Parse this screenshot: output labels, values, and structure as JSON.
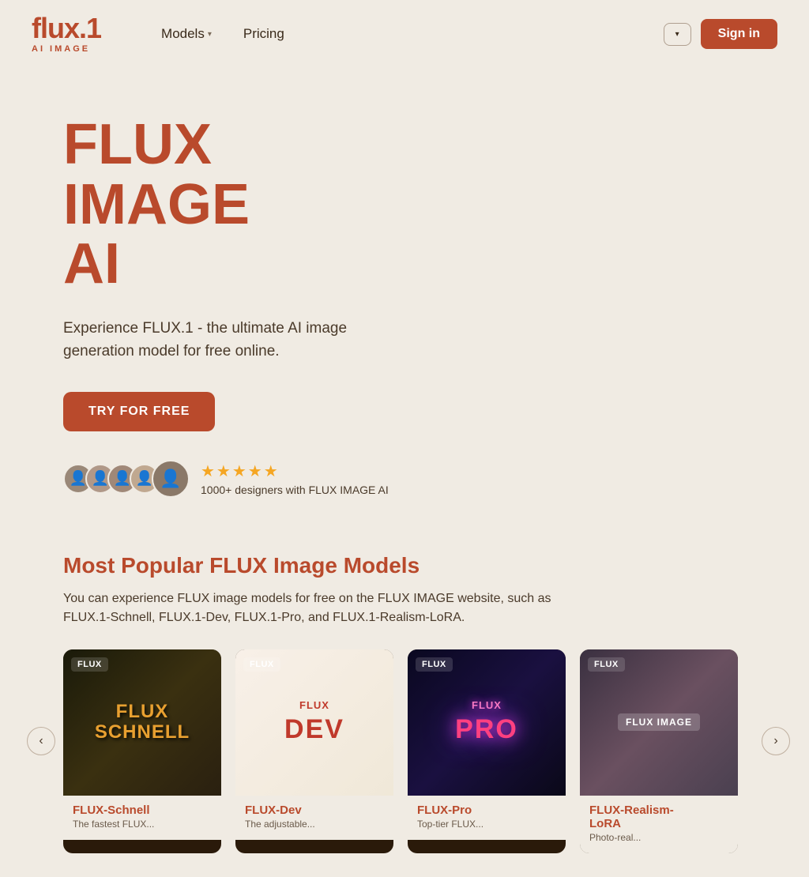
{
  "nav": {
    "logo": {
      "main": "flux.1",
      "sub": "AI IMAGE"
    },
    "models_label": "Models",
    "pricing_label": "Pricing",
    "lang_button": "▾",
    "signin_label": "Sign in"
  },
  "hero": {
    "title_line1": "FLUX IMAGE",
    "title_line2": "AI",
    "description": "Experience FLUX.1 - the ultimate AI image generation model for free online.",
    "cta_label": "TRY FOR FREE"
  },
  "social_proof": {
    "stars": "★★★★★",
    "text": "1000+ designers with FLUX IMAGE AI"
  },
  "models_section": {
    "heading": "Most Popular FLUX Image Models",
    "description": "You can experience FLUX image models for free on the FLUX IMAGE website, such as FLUX.1-Schnell, FLUX.1-Dev, FLUX.1-Pro, and FLUX.1-Realism-LoRA.",
    "cards": [
      {
        "badge": "FLUX",
        "name": "FLUX-Schnell",
        "subtitle": "The fastest FLUX...",
        "img_type": "schnell",
        "img_text": "FLUX\nSCHNELL"
      },
      {
        "badge": "FLUX",
        "name": "FLUX-Dev",
        "subtitle": "The adjustable...",
        "img_type": "dev",
        "img_text": "FLUX DEV"
      },
      {
        "badge": "FLUX",
        "name": "FLUX-Pro",
        "subtitle": "Top-tier FLUX...",
        "img_type": "pro",
        "img_text": "FLUX PRO"
      },
      {
        "badge": "FLUX",
        "name": "FLUX-Realism-LoRA",
        "subtitle": "Photo-real...",
        "img_type": "realism",
        "img_text": "FLUX IMAGE"
      }
    ]
  }
}
